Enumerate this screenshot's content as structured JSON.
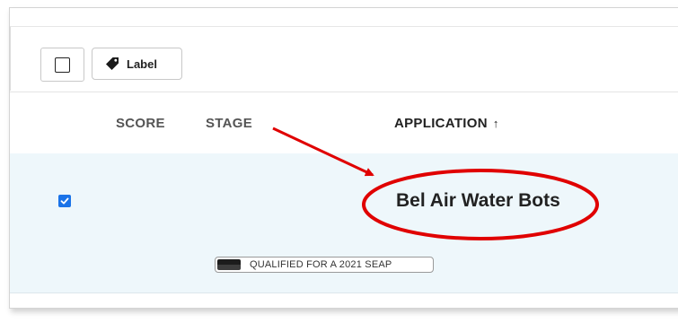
{
  "toolbar": {
    "label_button": "Label",
    "label_icon": "tag-icon"
  },
  "table": {
    "columns": [
      "SCORE",
      "STAGE",
      "APPLICATION"
    ],
    "sort_indicator": "↑",
    "rows": [
      {
        "selected": true,
        "application": "Bel Air Water Bots",
        "stage_badge": "QUALIFIED FOR A 2021 SEAP"
      }
    ]
  },
  "annotation": {
    "color": "#e00000",
    "shapes": [
      "arrow",
      "ellipse"
    ]
  },
  "colors": {
    "selected_row_bg": "#eef7fb",
    "checkbox_checked": "#1a73e8"
  }
}
